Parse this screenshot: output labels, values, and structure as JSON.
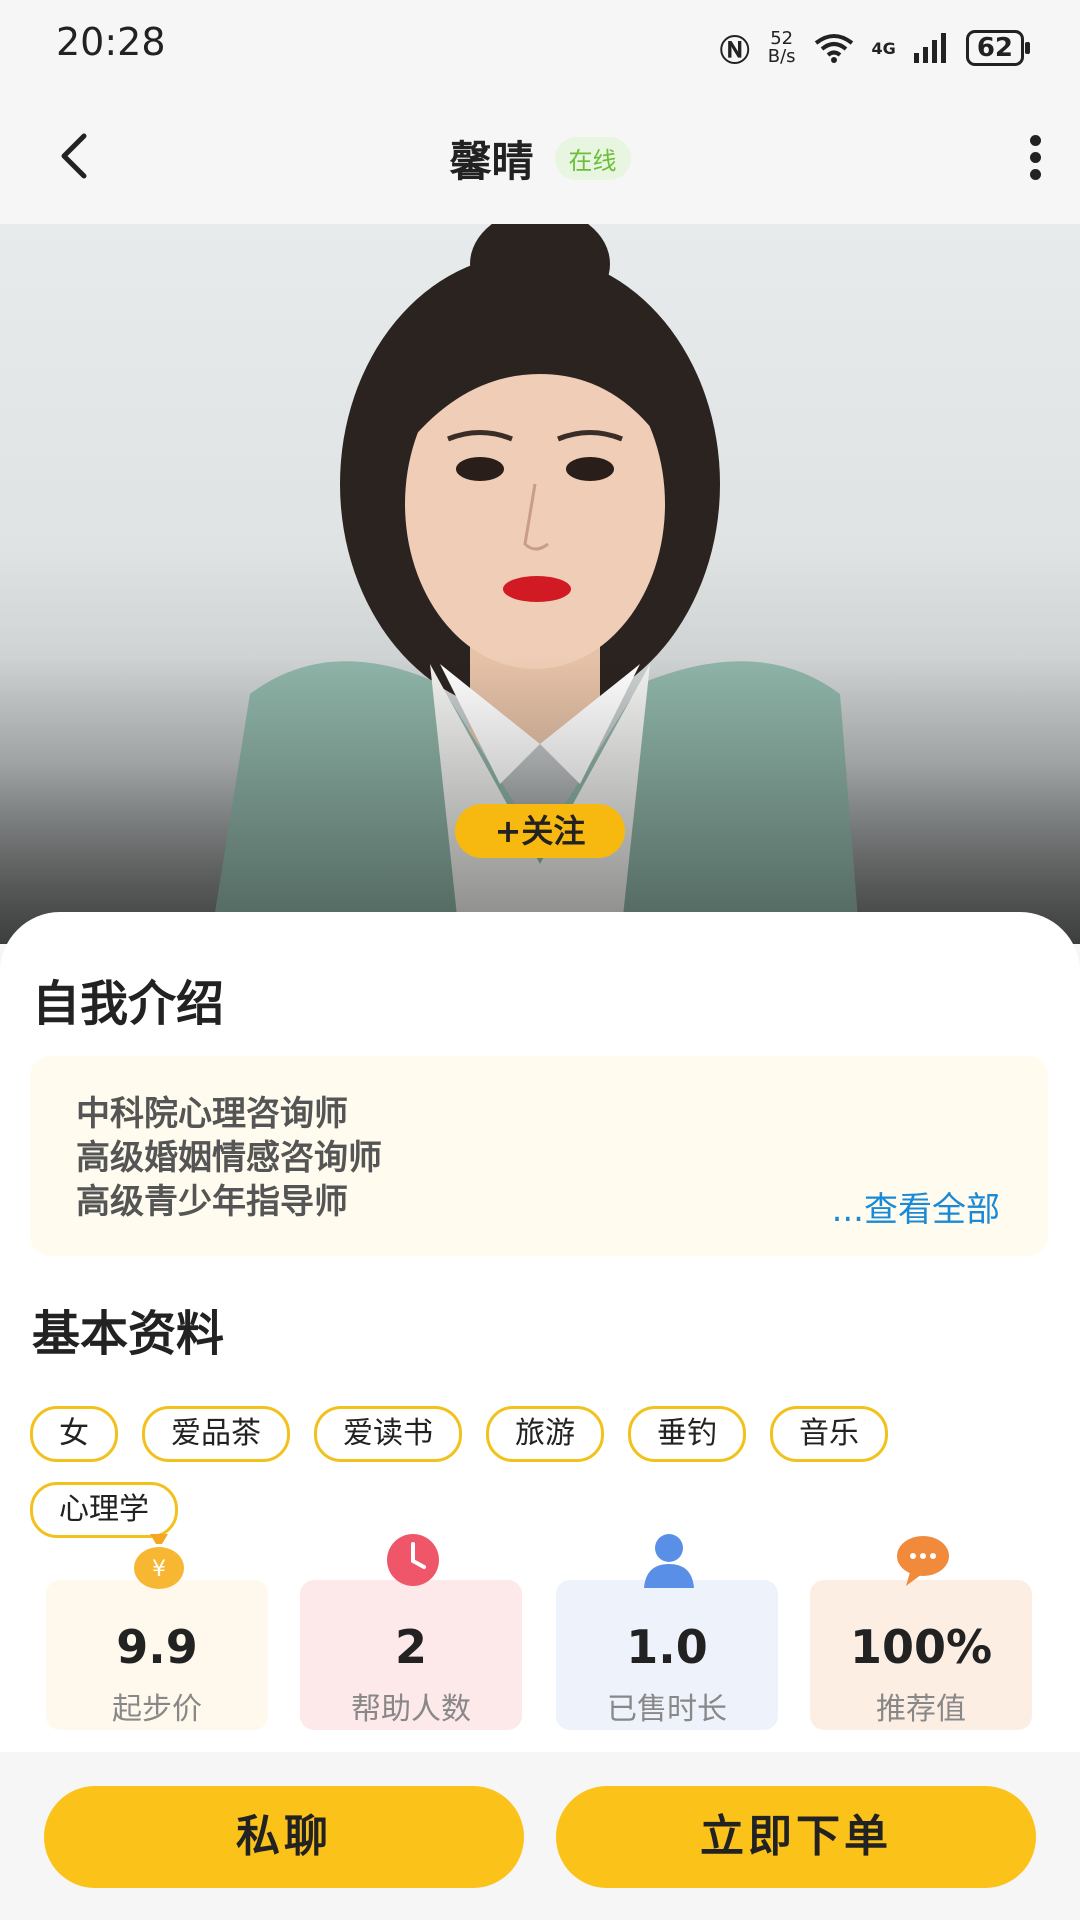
{
  "status_bar": {
    "time": "20:28",
    "net_speed_value": "52",
    "net_speed_unit": "B/s",
    "signal_label": "4G",
    "battery": "62"
  },
  "header": {
    "title": "馨晴",
    "status_badge": "在线"
  },
  "hero": {
    "follow_label": "+关注"
  },
  "intro": {
    "heading": "自我介绍",
    "lines": [
      "中科院心理咨询师",
      "高级婚姻情感咨询师",
      "高级青少年指导师"
    ],
    "see_all": "...查看全部"
  },
  "basic": {
    "heading": "基本资料",
    "tags": [
      "女",
      "爱品茶",
      "爱读书",
      "旅游",
      "垂钓",
      "音乐",
      "心理学"
    ]
  },
  "stats": [
    {
      "value": "9.9",
      "label": "起步价",
      "icon": "money-bag-icon",
      "bg": "#fff8ec"
    },
    {
      "value": "2",
      "label": "帮助人数",
      "icon": "clock-icon",
      "bg": "#fde8ea"
    },
    {
      "value": "1.0",
      "label": "已售时长",
      "icon": "person-icon",
      "bg": "#eef2fb"
    },
    {
      "value": "100%",
      "label": "推荐值",
      "icon": "chat-bubble-icon",
      "bg": "#fdeee4"
    }
  ],
  "actions": {
    "chat_label": "私聊",
    "order_label": "立即下单"
  },
  "colors": {
    "accent": "#fbc21a",
    "online_green": "#6cbf3a",
    "link_blue": "#1a8ad6"
  }
}
